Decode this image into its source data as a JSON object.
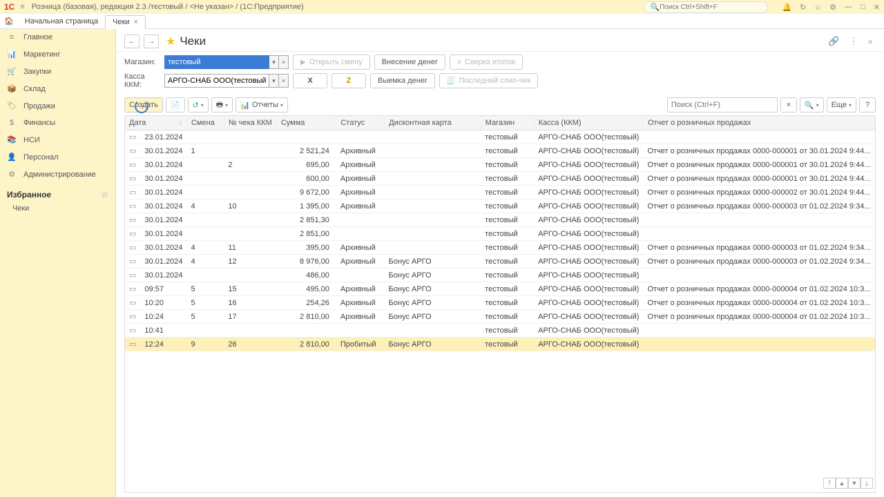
{
  "titlebar": {
    "logo": "1С",
    "title": "Розница (базовая), редакция 2.3 /тестовый / <Не указан> / (1С:Предприятие)",
    "search_placeholder": "Поиск Ctrl+Shift+F"
  },
  "tabs": {
    "start": "Начальная страница",
    "active": "Чеки"
  },
  "sidebar": {
    "items": [
      {
        "icon": "≡",
        "label": "Главное"
      },
      {
        "icon": "📊",
        "label": "Маркетинг"
      },
      {
        "icon": "🛒",
        "label": "Закупки"
      },
      {
        "icon": "📦",
        "label": "Склад"
      },
      {
        "icon": "🏷",
        "label": "Продажи"
      },
      {
        "icon": "$",
        "label": "Финансы"
      },
      {
        "icon": "📚",
        "label": "НСИ"
      },
      {
        "icon": "👤",
        "label": "Персонал"
      },
      {
        "icon": "⚙",
        "label": "Администрирование"
      }
    ],
    "favorites_title": "Избранное",
    "favorites": [
      "Чеки"
    ]
  },
  "page": {
    "title": "Чеки",
    "filters": {
      "shop_label": "Магазин:",
      "shop_value": "тестовый",
      "kassa_label": "Касса ККМ:",
      "kassa_value": "АРГО-СНАБ ООО(тестовый)"
    },
    "actions": {
      "open_shift": "Открыть смену",
      "deposit": "Внесение денег",
      "totals": "Сверка итогов",
      "x_label": "X",
      "z_label": "Z",
      "withdraw": "Выемка денег",
      "last_slip": "Последний слип-чек"
    },
    "toolbar": {
      "create": "Создать",
      "reports": "Отчеты",
      "search_placeholder": "Поиск (Ctrl+F)",
      "more": "Еще"
    }
  },
  "table": {
    "headers": {
      "date": "Дата",
      "smena": "Смена",
      "check_no": "№ чека ККМ",
      "sum": "Сумма",
      "status": "Статус",
      "card": "Дисконтная карта",
      "shop": "Магазин",
      "kassa": "Касса (ККМ)",
      "report": "Отчет о розничных продажах"
    },
    "rows": [
      {
        "date": "23.01.2024",
        "smena": "",
        "check": "",
        "sum": "",
        "status": "",
        "card": "",
        "shop": "тестовый",
        "kassa": "АРГО-СНАБ ООО(тестовый)",
        "report": ""
      },
      {
        "date": "30.01.2024",
        "smena": "1",
        "check": "",
        "sum": "2 521,24",
        "status": "Архивный",
        "card": "",
        "shop": "тестовый",
        "kassa": "АРГО-СНАБ ООО(тестовый)",
        "report": "Отчет о розничных продажах 0000-000001 от 30.01.2024 9:44..."
      },
      {
        "date": "30.01.2024",
        "smena": "",
        "check": "2",
        "sum": "695,00",
        "status": "Архивный",
        "card": "",
        "shop": "тестовый",
        "kassa": "АРГО-СНАБ ООО(тестовый)",
        "report": "Отчет о розничных продажах 0000-000001 от 30.01.2024 9:44..."
      },
      {
        "date": "30.01.2024",
        "smena": "",
        "check": "",
        "sum": "600,00",
        "status": "Архивный",
        "card": "",
        "shop": "тестовый",
        "kassa": "АРГО-СНАБ ООО(тестовый)",
        "report": "Отчет о розничных продажах 0000-000001 от 30.01.2024 9:44..."
      },
      {
        "date": "30.01.2024",
        "smena": "",
        "check": "",
        "sum": "9 672,00",
        "status": "Архивный",
        "card": "",
        "shop": "тестовый",
        "kassa": "АРГО-СНАБ ООО(тестовый)",
        "report": "Отчет о розничных продажах 0000-000002 от 30.01.2024 9:44..."
      },
      {
        "date": "30.01.2024",
        "smena": "4",
        "check": "10",
        "sum": "1 395,00",
        "status": "Архивный",
        "card": "",
        "shop": "тестовый",
        "kassa": "АРГО-СНАБ ООО(тестовый)",
        "report": "Отчет о розничных продажах 0000-000003 от 01.02.2024 9:34..."
      },
      {
        "date": "30.01.2024",
        "smena": "",
        "check": "",
        "sum": "2 851,30",
        "status": "",
        "card": "",
        "shop": "тестовый",
        "kassa": "АРГО-СНАБ ООО(тестовый)",
        "report": ""
      },
      {
        "date": "30.01.2024",
        "smena": "",
        "check": "",
        "sum": "2 851,00",
        "status": "",
        "card": "",
        "shop": "тестовый",
        "kassa": "АРГО-СНАБ ООО(тестовый)",
        "report": ""
      },
      {
        "date": "30.01.2024",
        "smena": "4",
        "check": "11",
        "sum": "395,00",
        "status": "Архивный",
        "card": "",
        "shop": "тестовый",
        "kassa": "АРГО-СНАБ ООО(тестовый)",
        "report": "Отчет о розничных продажах 0000-000003 от 01.02.2024 9:34..."
      },
      {
        "date": "30.01.2024",
        "smena": "4",
        "check": "12",
        "sum": "8 976,00",
        "status": "Архивный",
        "card": "Бонус АРГО",
        "shop": "тестовый",
        "kassa": "АРГО-СНАБ ООО(тестовый)",
        "report": "Отчет о розничных продажах 0000-000003 от 01.02.2024 9:34..."
      },
      {
        "date": "30.01.2024",
        "smena": "",
        "check": "",
        "sum": "486,00",
        "status": "",
        "card": "Бонус АРГО",
        "shop": "тестовый",
        "kassa": "АРГО-СНАБ ООО(тестовый)",
        "report": ""
      },
      {
        "date": "09:57",
        "smena": "5",
        "check": "15",
        "sum": "495,00",
        "status": "Архивный",
        "card": "Бонус АРГО",
        "shop": "тестовый",
        "kassa": "АРГО-СНАБ ООО(тестовый)",
        "report": "Отчет о розничных продажах 0000-000004 от 01.02.2024 10:3..."
      },
      {
        "date": "10:20",
        "smena": "5",
        "check": "16",
        "sum": "254,26",
        "status": "Архивный",
        "card": "Бонус АРГО",
        "shop": "тестовый",
        "kassa": "АРГО-СНАБ ООО(тестовый)",
        "report": "Отчет о розничных продажах 0000-000004 от 01.02.2024 10:3..."
      },
      {
        "date": "10:24",
        "smena": "5",
        "check": "17",
        "sum": "2 810,00",
        "status": "Архивный",
        "card": "Бонус АРГО",
        "shop": "тестовый",
        "kassa": "АРГО-СНАБ ООО(тестовый)",
        "report": "Отчет о розничных продажах 0000-000004 от 01.02.2024 10:3..."
      },
      {
        "date": "10:41",
        "smena": "",
        "check": "",
        "sum": "",
        "status": "",
        "card": "",
        "shop": "тестовый",
        "kassa": "АРГО-СНАБ ООО(тестовый)",
        "report": ""
      },
      {
        "date": "12:24",
        "smena": "9",
        "check": "26",
        "sum": "2 810,00",
        "status": "Пробитый",
        "card": "Бонус АРГО",
        "shop": "тестовый",
        "kassa": "АРГО-СНАБ ООО(тестовый)",
        "report": "",
        "selected": true
      }
    ]
  }
}
